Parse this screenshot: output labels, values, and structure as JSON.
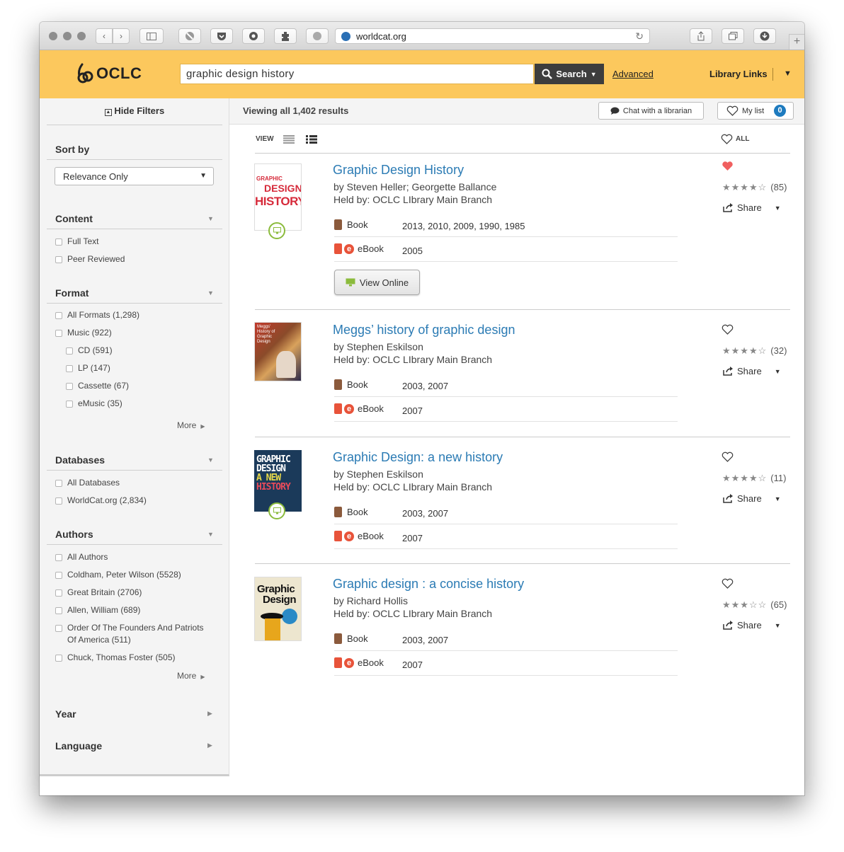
{
  "browser": {
    "url": "worldcat.org",
    "new_tab_label": "+"
  },
  "header": {
    "logo_text": "OCLC",
    "search_value": "graphic design history",
    "search_button": "Search",
    "advanced_link": "Advanced",
    "library_links": "Library Links",
    "accent_color": "#fcc85d"
  },
  "sidebar": {
    "hide_filters": "Hide Filters",
    "sort_by": {
      "label": "Sort by",
      "selected": "Relevance Only"
    },
    "content": {
      "label": "Content",
      "options": [
        "Full Text",
        "Peer Reviewed"
      ]
    },
    "format": {
      "label": "Format",
      "options": [
        "All Formats (1,298)",
        "Music (922)"
      ],
      "sub_options": [
        "CD (591)",
        "LP (147)",
        "Cassette (67)",
        "eMusic (35)"
      ],
      "more": "More"
    },
    "databases": {
      "label": "Databases",
      "options": [
        "All Databases",
        "WorldCat.org (2,834)"
      ]
    },
    "authors": {
      "label": "Authors",
      "options": [
        "All Authors",
        "Coldham, Peter Wilson (5528)",
        "Great Britain (2706)",
        "Allen, William (689)",
        "Order Of The Founders And Patriots Of America (511)",
        "Chuck, Thomas Foster (505)"
      ],
      "more": "More"
    },
    "year": {
      "label": "Year"
    },
    "language": {
      "label": "Language"
    }
  },
  "results_bar": {
    "viewing": "Viewing all 1,402 results",
    "chat": "Chat with a librarian",
    "my_list": "My list",
    "my_list_count": "0"
  },
  "view": {
    "label": "VIEW",
    "all_label": "ALL"
  },
  "results": [
    {
      "title": "Graphic Design History",
      "by": "by Steven Heller; Georgette Ballance",
      "held": "Held by: OCLC LIbrary Main Branch",
      "formats": [
        {
          "label": "Book",
          "years": "2013, 2010, 2009, 1990, 1985"
        },
        {
          "label": "eBook",
          "years": "2005"
        }
      ],
      "rating_count": "(85)",
      "share": "Share",
      "favorited": true,
      "view_online": "View Online",
      "cover": {
        "line1": "GRAPHIC",
        "line2": "DESIGN",
        "line3": "HISTORY"
      }
    },
    {
      "title": "Meggs’ history of graphic design",
      "by": "by Stephen Eskilson",
      "held": "Held by: OCLC LIbrary Main Branch",
      "formats": [
        {
          "label": "Book",
          "years": "2003, 2007"
        },
        {
          "label": "eBook",
          "years": "2007"
        }
      ],
      "rating_count": "(32)",
      "share": "Share",
      "favorited": false,
      "cover": {
        "line1": "Meggs'",
        "line2": "History of",
        "line3": "Graphic",
        "line4": "Design"
      }
    },
    {
      "title": "Graphic Design: a new history",
      "by": "by Stephen Eskilson",
      "held": "Held by: OCLC LIbrary Main Branch",
      "formats": [
        {
          "label": "Book",
          "years": "2003, 2007"
        },
        {
          "label": "eBook",
          "years": "2007"
        }
      ],
      "rating_count": "(11)",
      "share": "Share",
      "favorited": false,
      "cover": {
        "line1": "GRAPHIC",
        "line2": "DESIGN",
        "line3": "A NEW",
        "line4": "HISTORY"
      }
    },
    {
      "title": "Graphic design : a concise history",
      "by": "by Richard Hollis",
      "held": "Held by: OCLC LIbrary Main Branch",
      "formats": [
        {
          "label": "Book",
          "years": "2003, 2007"
        },
        {
          "label": "eBook",
          "years": "2007"
        }
      ],
      "rating_count": "(65)",
      "share": "Share",
      "favorited": false,
      "cover": {
        "line1": "Graphic",
        "line2": "Design"
      }
    }
  ],
  "icons": {
    "book_color": "#8b5a3c",
    "ebook_color": "#e8533a",
    "link_color": "#2b7bb4",
    "heart_fav_color": "#f06060"
  }
}
